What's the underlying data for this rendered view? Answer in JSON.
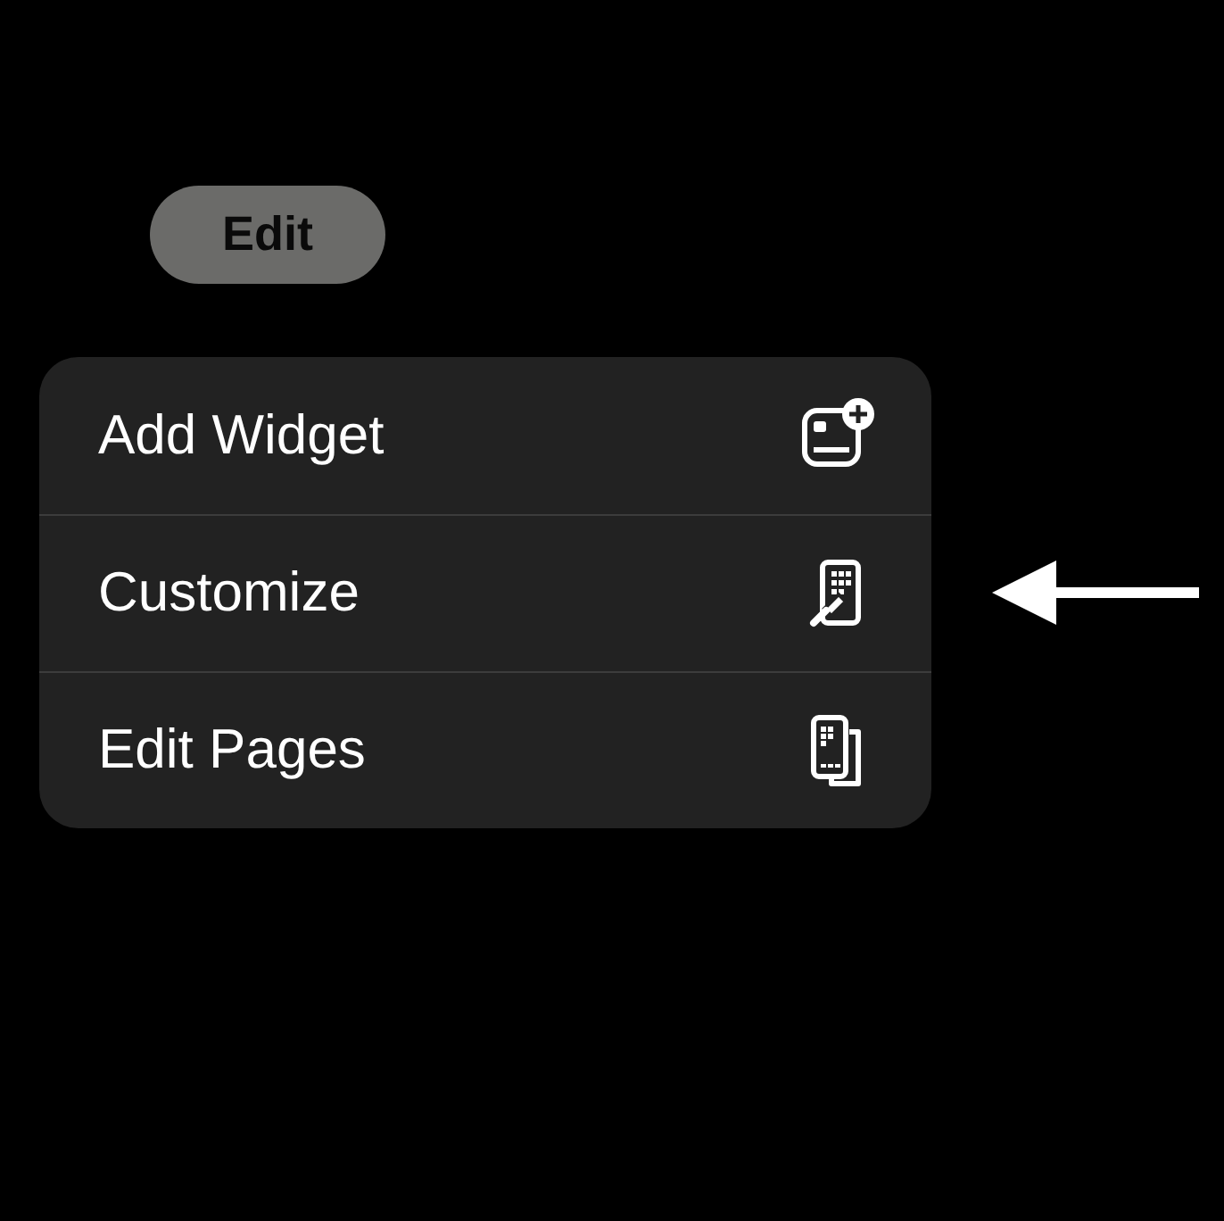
{
  "edit_button": {
    "label": "Edit"
  },
  "menu": {
    "items": [
      {
        "label": "Add Widget"
      },
      {
        "label": "Customize"
      },
      {
        "label": "Edit Pages"
      }
    ]
  }
}
